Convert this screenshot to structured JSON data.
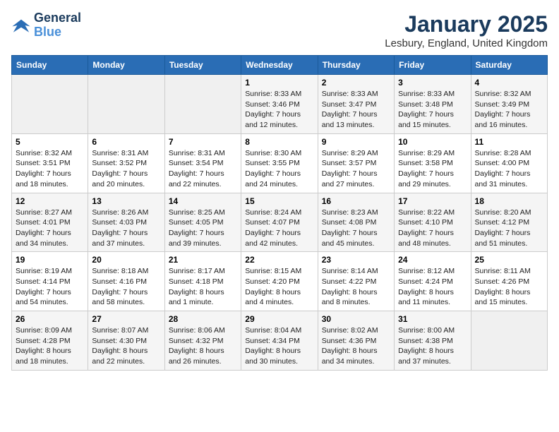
{
  "logo": {
    "line1": "General",
    "line2": "Blue"
  },
  "title": "January 2025",
  "subtitle": "Lesbury, England, United Kingdom",
  "headers": [
    "Sunday",
    "Monday",
    "Tuesday",
    "Wednesday",
    "Thursday",
    "Friday",
    "Saturday"
  ],
  "weeks": [
    [
      {
        "num": "",
        "info": ""
      },
      {
        "num": "",
        "info": ""
      },
      {
        "num": "",
        "info": ""
      },
      {
        "num": "1",
        "info": "Sunrise: 8:33 AM\nSunset: 3:46 PM\nDaylight: 7 hours\nand 12 minutes."
      },
      {
        "num": "2",
        "info": "Sunrise: 8:33 AM\nSunset: 3:47 PM\nDaylight: 7 hours\nand 13 minutes."
      },
      {
        "num": "3",
        "info": "Sunrise: 8:33 AM\nSunset: 3:48 PM\nDaylight: 7 hours\nand 15 minutes."
      },
      {
        "num": "4",
        "info": "Sunrise: 8:32 AM\nSunset: 3:49 PM\nDaylight: 7 hours\nand 16 minutes."
      }
    ],
    [
      {
        "num": "5",
        "info": "Sunrise: 8:32 AM\nSunset: 3:51 PM\nDaylight: 7 hours\nand 18 minutes."
      },
      {
        "num": "6",
        "info": "Sunrise: 8:31 AM\nSunset: 3:52 PM\nDaylight: 7 hours\nand 20 minutes."
      },
      {
        "num": "7",
        "info": "Sunrise: 8:31 AM\nSunset: 3:54 PM\nDaylight: 7 hours\nand 22 minutes."
      },
      {
        "num": "8",
        "info": "Sunrise: 8:30 AM\nSunset: 3:55 PM\nDaylight: 7 hours\nand 24 minutes."
      },
      {
        "num": "9",
        "info": "Sunrise: 8:29 AM\nSunset: 3:57 PM\nDaylight: 7 hours\nand 27 minutes."
      },
      {
        "num": "10",
        "info": "Sunrise: 8:29 AM\nSunset: 3:58 PM\nDaylight: 7 hours\nand 29 minutes."
      },
      {
        "num": "11",
        "info": "Sunrise: 8:28 AM\nSunset: 4:00 PM\nDaylight: 7 hours\nand 31 minutes."
      }
    ],
    [
      {
        "num": "12",
        "info": "Sunrise: 8:27 AM\nSunset: 4:01 PM\nDaylight: 7 hours\nand 34 minutes."
      },
      {
        "num": "13",
        "info": "Sunrise: 8:26 AM\nSunset: 4:03 PM\nDaylight: 7 hours\nand 37 minutes."
      },
      {
        "num": "14",
        "info": "Sunrise: 8:25 AM\nSunset: 4:05 PM\nDaylight: 7 hours\nand 39 minutes."
      },
      {
        "num": "15",
        "info": "Sunrise: 8:24 AM\nSunset: 4:07 PM\nDaylight: 7 hours\nand 42 minutes."
      },
      {
        "num": "16",
        "info": "Sunrise: 8:23 AM\nSunset: 4:08 PM\nDaylight: 7 hours\nand 45 minutes."
      },
      {
        "num": "17",
        "info": "Sunrise: 8:22 AM\nSunset: 4:10 PM\nDaylight: 7 hours\nand 48 minutes."
      },
      {
        "num": "18",
        "info": "Sunrise: 8:20 AM\nSunset: 4:12 PM\nDaylight: 7 hours\nand 51 minutes."
      }
    ],
    [
      {
        "num": "19",
        "info": "Sunrise: 8:19 AM\nSunset: 4:14 PM\nDaylight: 7 hours\nand 54 minutes."
      },
      {
        "num": "20",
        "info": "Sunrise: 8:18 AM\nSunset: 4:16 PM\nDaylight: 7 hours\nand 58 minutes."
      },
      {
        "num": "21",
        "info": "Sunrise: 8:17 AM\nSunset: 4:18 PM\nDaylight: 8 hours\nand 1 minute."
      },
      {
        "num": "22",
        "info": "Sunrise: 8:15 AM\nSunset: 4:20 PM\nDaylight: 8 hours\nand 4 minutes."
      },
      {
        "num": "23",
        "info": "Sunrise: 8:14 AM\nSunset: 4:22 PM\nDaylight: 8 hours\nand 8 minutes."
      },
      {
        "num": "24",
        "info": "Sunrise: 8:12 AM\nSunset: 4:24 PM\nDaylight: 8 hours\nand 11 minutes."
      },
      {
        "num": "25",
        "info": "Sunrise: 8:11 AM\nSunset: 4:26 PM\nDaylight: 8 hours\nand 15 minutes."
      }
    ],
    [
      {
        "num": "26",
        "info": "Sunrise: 8:09 AM\nSunset: 4:28 PM\nDaylight: 8 hours\nand 18 minutes."
      },
      {
        "num": "27",
        "info": "Sunrise: 8:07 AM\nSunset: 4:30 PM\nDaylight: 8 hours\nand 22 minutes."
      },
      {
        "num": "28",
        "info": "Sunrise: 8:06 AM\nSunset: 4:32 PM\nDaylight: 8 hours\nand 26 minutes."
      },
      {
        "num": "29",
        "info": "Sunrise: 8:04 AM\nSunset: 4:34 PM\nDaylight: 8 hours\nand 30 minutes."
      },
      {
        "num": "30",
        "info": "Sunrise: 8:02 AM\nSunset: 4:36 PM\nDaylight: 8 hours\nand 34 minutes."
      },
      {
        "num": "31",
        "info": "Sunrise: 8:00 AM\nSunset: 4:38 PM\nDaylight: 8 hours\nand 37 minutes."
      },
      {
        "num": "",
        "info": ""
      }
    ]
  ]
}
